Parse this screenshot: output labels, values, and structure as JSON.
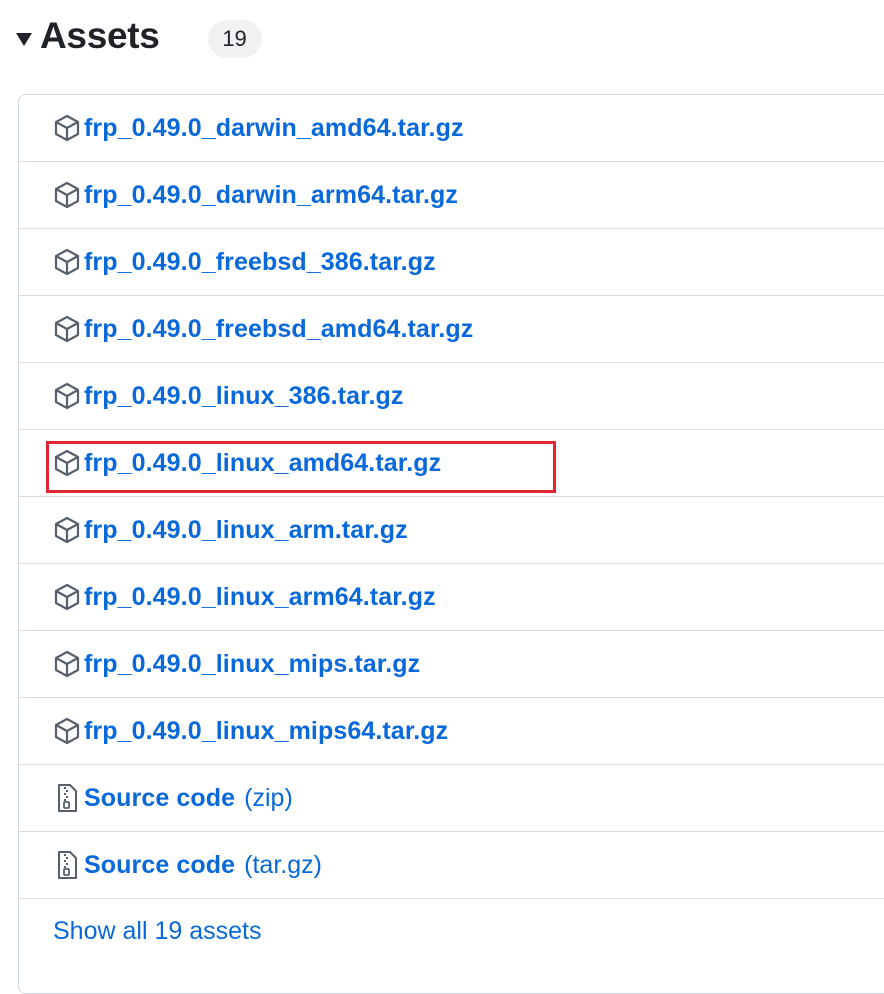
{
  "header": {
    "title": "Assets",
    "count": "19"
  },
  "assets": [
    {
      "name": "frp_0.49.0_darwin_amd64.tar.gz",
      "icon": "package-icon"
    },
    {
      "name": "frp_0.49.0_darwin_arm64.tar.gz",
      "icon": "package-icon"
    },
    {
      "name": "frp_0.49.0_freebsd_386.tar.gz",
      "icon": "package-icon"
    },
    {
      "name": "frp_0.49.0_freebsd_amd64.tar.gz",
      "icon": "package-icon"
    },
    {
      "name": "frp_0.49.0_linux_386.tar.gz",
      "icon": "package-icon"
    },
    {
      "name": "frp_0.49.0_linux_amd64.tar.gz",
      "icon": "package-icon"
    },
    {
      "name": "frp_0.49.0_linux_arm.tar.gz",
      "icon": "package-icon"
    },
    {
      "name": "frp_0.49.0_linux_arm64.tar.gz",
      "icon": "package-icon"
    },
    {
      "name": "frp_0.49.0_linux_mips.tar.gz",
      "icon": "package-icon"
    },
    {
      "name": "frp_0.49.0_linux_mips64.tar.gz",
      "icon": "package-icon"
    }
  ],
  "source_code": [
    {
      "name": "Source code",
      "suffix": "(zip)",
      "icon": "file-zip-icon"
    },
    {
      "name": "Source code",
      "suffix": "(tar.gz)",
      "icon": "file-zip-icon"
    }
  ],
  "show_all_label": "Show all 19 assets",
  "colors": {
    "link": "#0969da",
    "highlight": "#e02633",
    "border": "#d0d7de",
    "badge_bg": "#eff1f3"
  }
}
